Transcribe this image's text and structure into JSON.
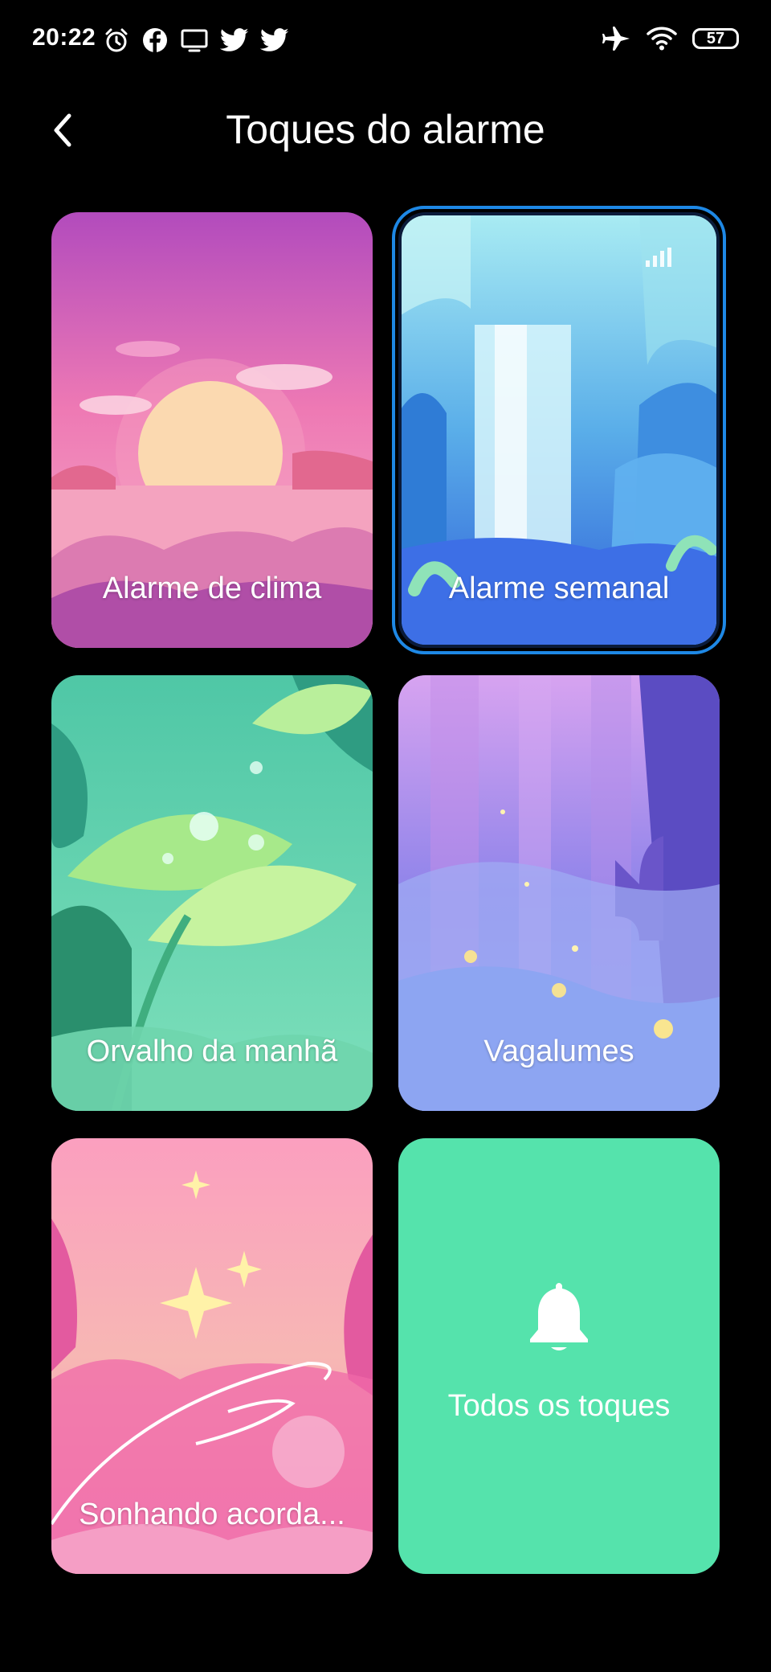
{
  "status_bar": {
    "time": "20:22",
    "left_icons": [
      "alarm-clock-icon",
      "facebook-icon",
      "tv-icon",
      "twitter-icon",
      "twitter-icon"
    ],
    "right_icons": [
      "airplane-mode-icon",
      "wifi-icon"
    ],
    "battery": "57"
  },
  "header": {
    "title": "Toques do alarme",
    "back_icon": "chevron-left-icon"
  },
  "cards": [
    {
      "label": "Alarme de clima",
      "theme": "pink-sunset",
      "selected": false
    },
    {
      "label": "Alarme semanal",
      "theme": "blue-waterfall",
      "selected": true
    },
    {
      "label": "Orvalho da manhã",
      "theme": "green-leaves",
      "selected": false
    },
    {
      "label": "Vagalumes",
      "theme": "purple-fireflies",
      "selected": false
    },
    {
      "label": "Sonhando acorda...",
      "theme": "pink-dream",
      "selected": false
    },
    {
      "label": "Todos os toques",
      "theme": "green-solid",
      "icon": "bell-icon",
      "selected": false
    }
  ],
  "colors": {
    "background": "#000000",
    "selection_ring": "#1e88e5",
    "all_tones_card": "#55e3ac"
  }
}
